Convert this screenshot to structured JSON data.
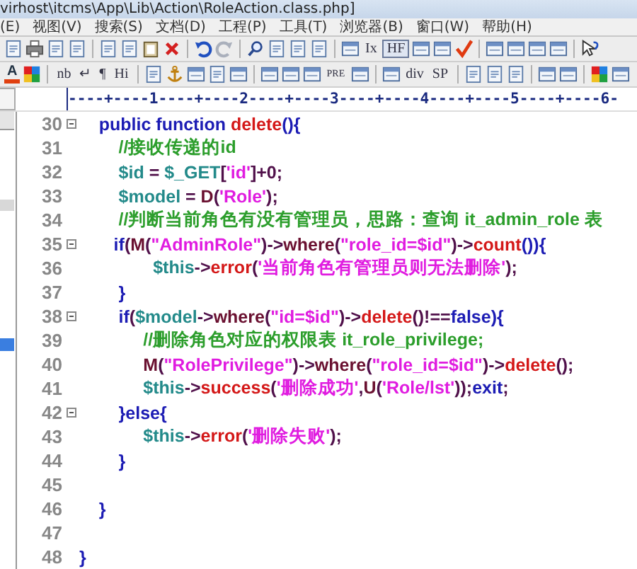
{
  "window": {
    "title": "virhost\\itcms\\App\\Lib\\Action\\RoleAction.class.php]"
  },
  "menu": [
    "(E)",
    "视图(V)",
    "搜索(S)",
    "文档(D)",
    "工程(P)",
    "工具(T)",
    "浏览器(B)",
    "窗口(W)",
    "帮助(H)"
  ],
  "toolbar_1": {
    "labels": [
      {
        "text": "Ix",
        "kind": "text"
      },
      {
        "text": "HF",
        "kind": "boxed"
      }
    ]
  },
  "toolbar_2": {
    "labels": [
      {
        "text": "A",
        "kind": "font-color"
      },
      {
        "text": "nb",
        "kind": "text"
      },
      {
        "text": "↵",
        "kind": "text"
      },
      {
        "text": "¶",
        "kind": "text"
      },
      {
        "text": "Hi",
        "kind": "text"
      },
      {
        "text": "PRE",
        "kind": "small"
      },
      {
        "text": "div",
        "kind": "text"
      },
      {
        "text": "SP",
        "kind": "text"
      }
    ]
  },
  "ruler": "----+----1----+----2----+----3----+----4----+----5----+----6-",
  "code": [
    {
      "number": "30",
      "foldable": true,
      "tokens": [
        {
          "text": "    public function ",
          "kind": "kw"
        },
        {
          "text": "delete",
          "kind": "fn"
        },
        {
          "text": "(){",
          "kind": "kw"
        }
      ]
    },
    {
      "number": "31",
      "foldable": false,
      "tokens": [
        {
          "text": "        //接收传递的id",
          "kind": "cmt"
        }
      ]
    },
    {
      "number": "32",
      "foldable": false,
      "tokens": [
        {
          "text": "        $id",
          "kind": "var"
        },
        {
          "text": " = ",
          "kind": "op"
        },
        {
          "text": "$_GET",
          "kind": "var"
        },
        {
          "text": "[",
          "kind": "op"
        },
        {
          "text": "'id'",
          "kind": "str"
        },
        {
          "text": "]+0;",
          "kind": "op"
        }
      ]
    },
    {
      "number": "33",
      "foldable": false,
      "tokens": [
        {
          "text": "        $model",
          "kind": "var"
        },
        {
          "text": " = ",
          "kind": "op"
        },
        {
          "text": "D",
          "kind": "method"
        },
        {
          "text": "(",
          "kind": "op"
        },
        {
          "text": "'Role'",
          "kind": "str"
        },
        {
          "text": ");",
          "kind": "op"
        }
      ]
    },
    {
      "number": "34",
      "foldable": false,
      "tokens": [
        {
          "text": "        //判断当前角色有没有管理员，思路：查询 it_admin_role 表",
          "kind": "cmt"
        }
      ]
    },
    {
      "number": "35",
      "foldable": true,
      "tokens": [
        {
          "text": "       if",
          "kind": "kw"
        },
        {
          "text": "(",
          "kind": "op"
        },
        {
          "text": "M",
          "kind": "method"
        },
        {
          "text": "(",
          "kind": "op"
        },
        {
          "text": "\"AdminRole\"",
          "kind": "str"
        },
        {
          "text": ")->",
          "kind": "op"
        },
        {
          "text": "where",
          "kind": "method"
        },
        {
          "text": "(",
          "kind": "op"
        },
        {
          "text": "\"role_id=$id\"",
          "kind": "str"
        },
        {
          "text": ")->",
          "kind": "op"
        },
        {
          "text": "count",
          "kind": "fn"
        },
        {
          "text": "()){",
          "kind": "kw"
        }
      ]
    },
    {
      "number": "36",
      "foldable": false,
      "tokens": [
        {
          "text": "               $this",
          "kind": "var"
        },
        {
          "text": "->",
          "kind": "op"
        },
        {
          "text": "error",
          "kind": "fn"
        },
        {
          "text": "(",
          "kind": "op"
        },
        {
          "text": "'当前角色有管理员则无法删除'",
          "kind": "str"
        },
        {
          "text": ");",
          "kind": "op"
        }
      ]
    },
    {
      "number": "37",
      "foldable": false,
      "tokens": [
        {
          "text": "        }",
          "kind": "kw"
        }
      ]
    },
    {
      "number": "38",
      "foldable": true,
      "tokens": [
        {
          "text": "        if",
          "kind": "kw"
        },
        {
          "text": "(",
          "kind": "op"
        },
        {
          "text": "$model",
          "kind": "var"
        },
        {
          "text": "->",
          "kind": "op"
        },
        {
          "text": "where",
          "kind": "method"
        },
        {
          "text": "(",
          "kind": "op"
        },
        {
          "text": "\"id=$id\"",
          "kind": "str"
        },
        {
          "text": ")->",
          "kind": "op"
        },
        {
          "text": "delete",
          "kind": "fn"
        },
        {
          "text": "()!==",
          "kind": "op"
        },
        {
          "text": "false",
          "kind": "kw"
        },
        {
          "text": "){",
          "kind": "kw"
        }
      ]
    },
    {
      "number": "39",
      "foldable": false,
      "tokens": [
        {
          "text": "             //删除角色对应的权限表 it_role_privilege;",
          "kind": "cmt"
        }
      ]
    },
    {
      "number": "40",
      "foldable": false,
      "tokens": [
        {
          "text": "             M",
          "kind": "method"
        },
        {
          "text": "(",
          "kind": "op"
        },
        {
          "text": "\"RolePrivilege\"",
          "kind": "str"
        },
        {
          "text": ")->",
          "kind": "op"
        },
        {
          "text": "where",
          "kind": "method"
        },
        {
          "text": "(",
          "kind": "op"
        },
        {
          "text": "\"role_id=$id\"",
          "kind": "str"
        },
        {
          "text": ")->",
          "kind": "op"
        },
        {
          "text": "delete",
          "kind": "fn"
        },
        {
          "text": "();",
          "kind": "op"
        }
      ]
    },
    {
      "number": "41",
      "foldable": false,
      "tokens": [
        {
          "text": "             $this",
          "kind": "var"
        },
        {
          "text": "->",
          "kind": "op"
        },
        {
          "text": "success",
          "kind": "fn"
        },
        {
          "text": "(",
          "kind": "op"
        },
        {
          "text": "'删除成功'",
          "kind": "str"
        },
        {
          "text": ",",
          "kind": "op"
        },
        {
          "text": "U",
          "kind": "method"
        },
        {
          "text": "(",
          "kind": "op"
        },
        {
          "text": "'Role/lst'",
          "kind": "str"
        },
        {
          "text": "));",
          "kind": "op"
        },
        {
          "text": "exit",
          "kind": "kw"
        },
        {
          "text": ";",
          "kind": "op"
        }
      ]
    },
    {
      "number": "42",
      "foldable": true,
      "tokens": [
        {
          "text": "        }else{",
          "kind": "kw"
        }
      ]
    },
    {
      "number": "43",
      "foldable": false,
      "tokens": [
        {
          "text": "             $this",
          "kind": "var"
        },
        {
          "text": "->",
          "kind": "op"
        },
        {
          "text": "error",
          "kind": "fn"
        },
        {
          "text": "(",
          "kind": "op"
        },
        {
          "text": "'删除失败'",
          "kind": "str"
        },
        {
          "text": ");",
          "kind": "op"
        }
      ]
    },
    {
      "number": "44",
      "foldable": false,
      "tokens": [
        {
          "text": "        }",
          "kind": "kw"
        }
      ]
    },
    {
      "number": "45",
      "foldable": false
    },
    {
      "number": "46",
      "foldable": false,
      "tokens": [
        {
          "text": "    }",
          "kind": "kw"
        }
      ]
    },
    {
      "number": "47",
      "foldable": false
    },
    {
      "number": "48",
      "foldable": false,
      "tokens": [
        {
          "text": "}",
          "kind": "kw"
        }
      ]
    }
  ]
}
